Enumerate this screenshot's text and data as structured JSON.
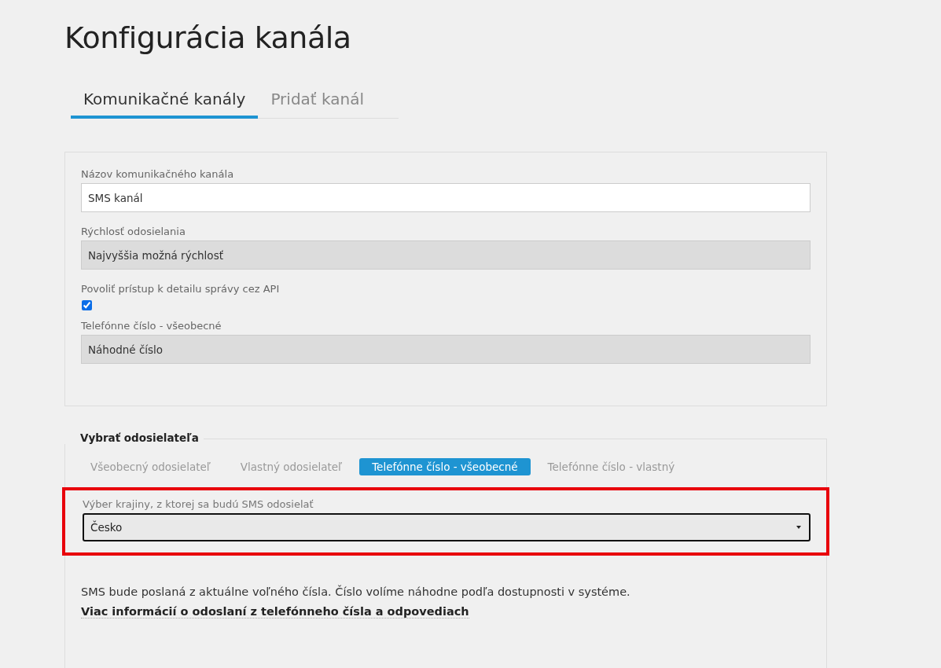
{
  "page_title": "Konfigurácia kanála",
  "tabs": [
    {
      "label": "Komunikačné kanály",
      "selected": true
    },
    {
      "label": "Pridať kanál",
      "selected": false
    }
  ],
  "settings": [
    {
      "kind": "text",
      "label": "Názov komunikačného kanála",
      "value": "SMS kanál",
      "disabled": false
    },
    {
      "kind": "text",
      "label": "Rýchlosť odosielania",
      "value": "Najvyššia možná rýchlosť",
      "disabled": true
    },
    {
      "kind": "checkbox",
      "label": "Povoliť prístup k detailu správy cez API",
      "checked": true
    },
    {
      "kind": "text",
      "label": "Telefónne číslo - všeobecné",
      "value": "Náhodné číslo",
      "disabled": true
    }
  ],
  "sender": {
    "legend": "Vybrať odosielateľa",
    "options": [
      {
        "label": "Všeobecný odosielateľ",
        "selected": false
      },
      {
        "label": "Vlastný odosielateľ",
        "selected": false
      },
      {
        "label": "Telefónne číslo - všeobecné",
        "selected": true
      },
      {
        "label": "Telefónne číslo - vlastný",
        "selected": false
      }
    ],
    "country": {
      "label": "Výber krajiny, z ktorej sa budú SMS odosielať",
      "value": "Česko",
      "highlighted": true
    },
    "note": {
      "text": "SMS bude poslaná z aktuálne voľného čísla. Číslo volíme náhodne podľa dostupnosti v systéme.",
      "link": "Viac informácií o odoslaní z telefónneho čísla a odpovediach"
    }
  }
}
